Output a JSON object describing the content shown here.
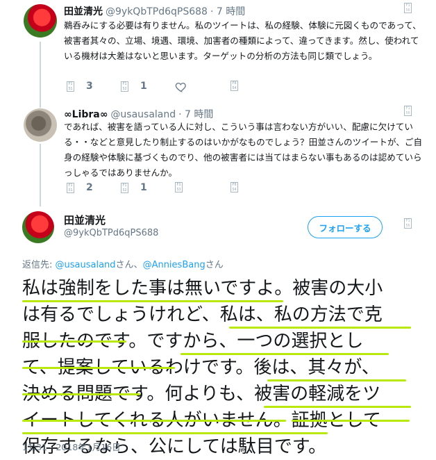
{
  "tweets": [
    {
      "author": "田並清光",
      "handle": "@9ykQbTPd6qPS688",
      "time": "· 7 時間",
      "text": "鵜呑みにする必要は有りません。私のツイートは、私の経験、体験に元図くものであって、被害者其々の、立場、境遇、環境、加害者の種類によって、違ってきます。然し、使われている機材は大差はないと思います。ターゲットの分析の方法も同じ類でしょう。",
      "reply_count": "3",
      "retweet_count": "1",
      "like_count": ""
    },
    {
      "author": "∞Libra∞",
      "handle": "@usausaland",
      "time": "· 7 時間",
      "text": "であれば、被害を語っている人に対し、こういう事は言わない方がいい、配慮に欠けている・・などと意見したり制止するのはいかがなものでしょう？田並さんのツイートが、ご自身の経験や体験に基づくものでり、他の被害者には当てはまらない事もあるのは認めていらっしゃるではありませんか。",
      "reply_count": "2",
      "retweet_count": "1",
      "like_count": ""
    }
  ],
  "main_tweet": {
    "author": "田並清光",
    "handle": "@9ykQbTPd6qPS688",
    "follow_label": "フォローする",
    "reply_prefix": "返信先: ",
    "reply_user1": "@usausaland",
    "reply_mid": "さん、",
    "reply_user2": "@AnniesBang",
    "reply_suffix": "さん",
    "lines": [
      "私は強制をした事は無いですよ。被害の大小",
      "は有るでしょうけれど、私は、私の方法で克",
      "服したのです。ですから、一つの選択とし",
      "て、提案しているわけです。後は、其々が、",
      "決める問題です。何よりも、被害の軽減をツ",
      "イートしてくれる人がいません。証拠として",
      "保存するなら、公にしては駄目です。"
    ],
    "timestamp": "11:31 - 2018年1月16日"
  },
  "icons": {
    "reply": "reply-icon",
    "retweet": "retweet-icon",
    "like": "heart-icon",
    "more": "more-icon"
  },
  "colors": {
    "accent": "#1da1f2",
    "highlight": "#b8e80c",
    "muted": "#657786"
  }
}
